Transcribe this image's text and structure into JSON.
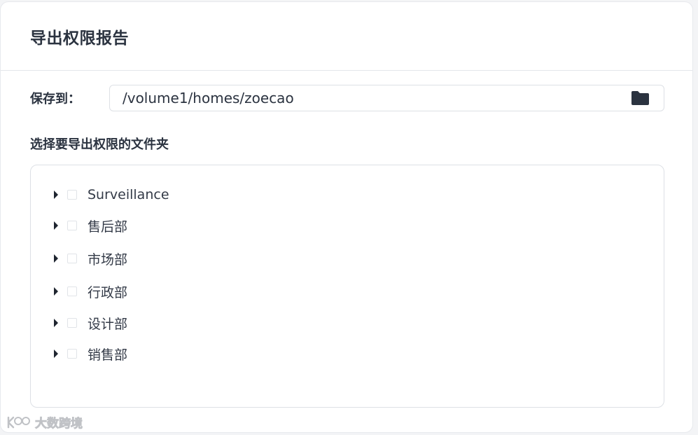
{
  "dialog": {
    "title": "导出权限报告"
  },
  "save_to": {
    "label": "保存到：",
    "path": "/volume1/homes/zoecao",
    "browse_icon": "folder-icon"
  },
  "folder_select": {
    "label": "选择要导出权限的文件夹",
    "items": [
      {
        "label": "Surveillance",
        "checked": false
      },
      {
        "label": "售后部",
        "checked": false
      },
      {
        "label": "市场部",
        "checked": false
      },
      {
        "label": "行政部",
        "checked": false
      },
      {
        "label": "设计部",
        "checked": false
      },
      {
        "label": "销售部",
        "checked": false
      }
    ]
  },
  "watermark": {
    "text": "大数跨境"
  },
  "colors": {
    "text": "#2b3340",
    "border": "#dde0e5",
    "icon": "#2b3340"
  }
}
